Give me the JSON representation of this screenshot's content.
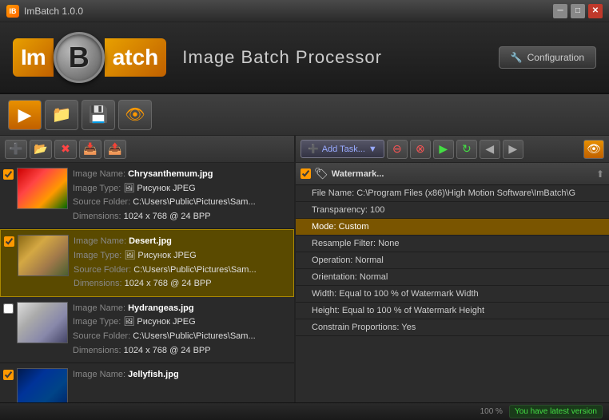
{
  "titlebar": {
    "title": "ImBatch 1.0.0",
    "min_label": "─",
    "max_label": "□",
    "close_label": "✕"
  },
  "header": {
    "logo_im": "Im",
    "logo_b": "B",
    "logo_atch": "atch",
    "app_title": "Image Batch Processor",
    "config_label": "Configuration",
    "config_icon": "🔧"
  },
  "toolbar": {
    "btn1_icon": "▶",
    "btn2_icon": "📁",
    "btn3_icon": "💾",
    "btn4_icon": "👁"
  },
  "file_toolbar": {
    "add_icon": "➕",
    "folder_icon": "📂",
    "remove_icon": "✖",
    "move_up_icon": "⬆",
    "move_down_icon": "⬇"
  },
  "files": [
    {
      "name": "Chrysanthemum.jpg",
      "type": "Рисунок JPEG",
      "source": "C:\\Users\\Public\\Pictures\\Sam...",
      "dimensions": "1024 x 768 @ 24 BPP",
      "checked": true,
      "thumb_class": "thumb-chrysanthemum"
    },
    {
      "name": "Desert.jpg",
      "type": "Рисунок JPEG",
      "source": "C:\\Users\\Public\\Pictures\\Sam...",
      "dimensions": "1024 x 768 @ 24 BPP",
      "checked": true,
      "selected": true,
      "thumb_class": "thumb-desert"
    },
    {
      "name": "Hydrangeas.jpg",
      "type": "Рисунок JPEG",
      "source": "C:\\Users\\Public\\Pictures\\Sam...",
      "dimensions": "1024 x 768 @ 24 BPP",
      "checked": false,
      "thumb_class": "thumb-hydrangeas"
    },
    {
      "name": "Jellyfish.jpg",
      "type": "",
      "source": "",
      "dimensions": "",
      "checked": true,
      "thumb_class": "thumb-jellyfish"
    }
  ],
  "task_toolbar": {
    "add_task_label": "Add Task...",
    "add_icon": "➕",
    "remove_icon": "⊖",
    "cancel_icon": "⊗",
    "play_icon": "▶",
    "refresh_icon": "↻",
    "eye_icon": "👁"
  },
  "tasks": {
    "section_title": "Watermark...",
    "rows": [
      {
        "label": "File Name: C:\\Program Files (x86)\\High Motion Software\\ImBatch\\G",
        "highlighted": false,
        "checked": false
      },
      {
        "label": "Transparency: 100",
        "highlighted": false,
        "checked": false
      },
      {
        "label": "Mode: Custom",
        "highlighted": true,
        "checked": false
      },
      {
        "label": "Resample Filter: None",
        "highlighted": false,
        "checked": false
      },
      {
        "label": "Operation: Normal",
        "highlighted": false,
        "checked": false
      },
      {
        "label": "Orientation: Normal",
        "highlighted": false,
        "checked": false
      },
      {
        "label": "Width: Equal to 100 % of Watermark Width",
        "highlighted": false,
        "checked": false
      },
      {
        "label": "Height: Equal to 100 % of Watermark Height",
        "highlighted": false,
        "checked": false
      },
      {
        "label": "Constrain Proportions: Yes",
        "highlighted": false,
        "checked": false
      }
    ]
  },
  "status": {
    "zoom": "100 %",
    "latest_label": "You have latest version"
  }
}
